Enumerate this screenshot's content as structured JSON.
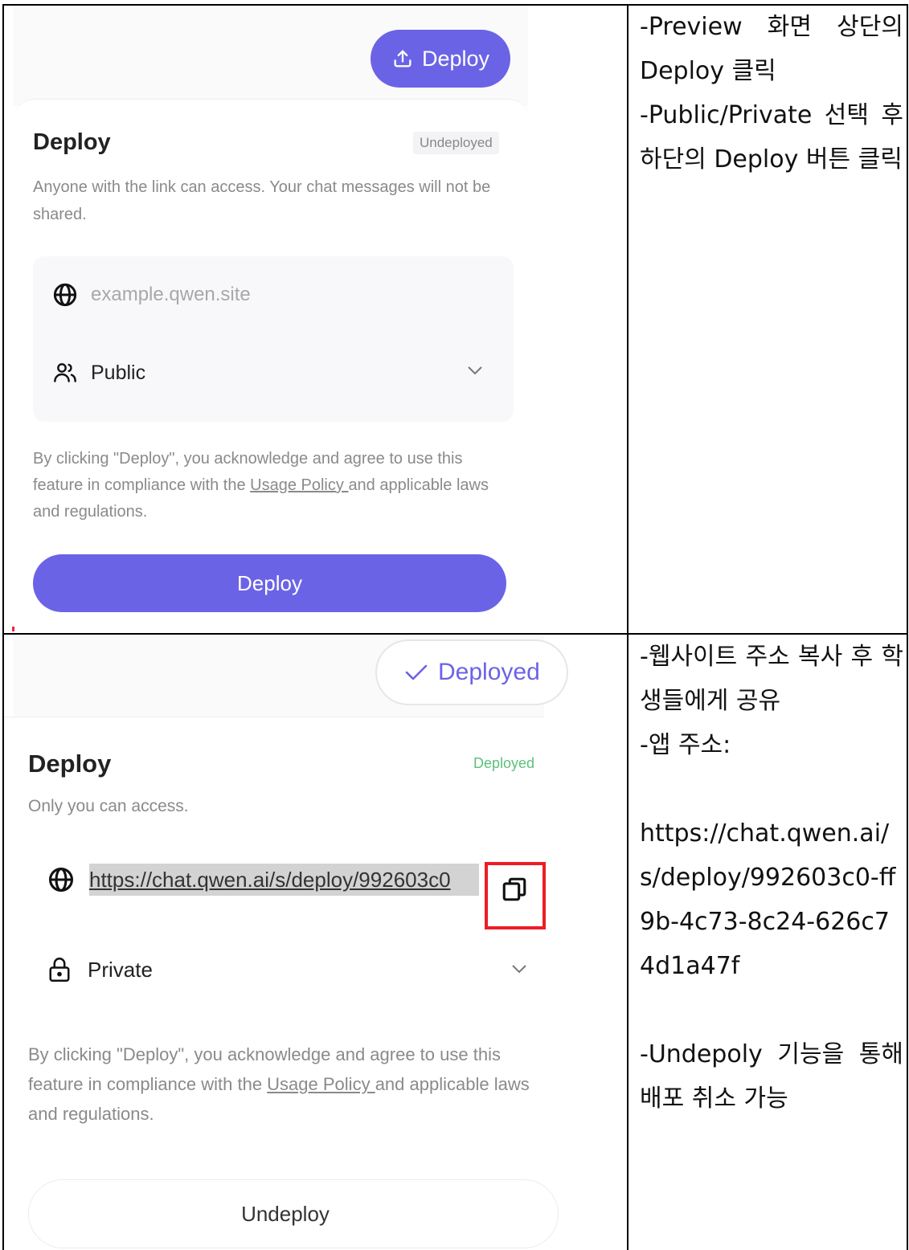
{
  "panel1": {
    "top_button_label": "Deploy",
    "title": "Deploy",
    "status_badge": "Undeployed",
    "description": "Anyone with the link can access. Your chat messages will not be shared.",
    "url_placeholder": "example.qwen.site",
    "visibility": "Public",
    "legal_before": "By clicking \"Deploy\", you acknowledge and agree to use this feature in compliance with the ",
    "legal_link": "Usage Policy ",
    "legal_after": "and applicable laws and regulations.",
    "deploy_button_label": "Deploy"
  },
  "panel2": {
    "top_button_label": "Deployed",
    "title": "Deploy",
    "status_badge": "Deployed",
    "description": "Only you can access.",
    "url": "https://chat.qwen.ai/s/deploy/992603c0",
    "visibility": "Private",
    "legal_before": "By clicking \"Deploy\", you acknowledge and agree to use this feature in compliance with the ",
    "legal_link": "Usage Policy ",
    "legal_after": "and applicable laws and regulations.",
    "undeploy_button_label": "Undeploy"
  },
  "notes1": {
    "line1": "-Preview 화면 상단의 Deploy 클릭",
    "line2": "-Public/Private 선택 후 하단의 Deploy 버튼 클릭"
  },
  "notes2": {
    "line1": "-웹사이트 주소 복사 후 학생들에게 공유",
    "line2": "-앱 주소:",
    "url": "https://chat.qwen.ai/s/deploy/992603c0-ff9b-4c73-8c24-626c74d1a47f",
    "line3": "-Undepoly 기능을 통해 배포 취소 가능"
  },
  "colors": {
    "accent": "#6b63e6",
    "deployed_green": "#5cc07a",
    "highlight_red": "#ee1c24"
  },
  "icons": [
    "upload-icon",
    "globe-icon",
    "users-icon",
    "chevron-down-icon",
    "check-icon",
    "copy-icon",
    "lock-icon"
  ]
}
